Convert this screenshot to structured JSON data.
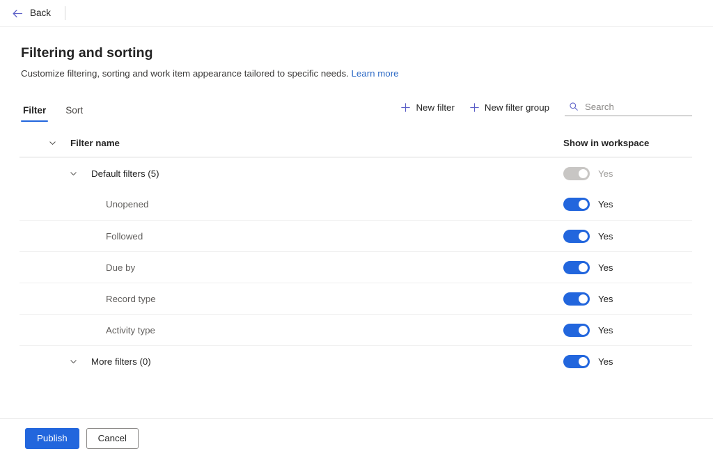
{
  "topbar": {
    "back_label": "Back",
    "back_icon": "arrow-left-icon"
  },
  "header": {
    "title": "Filtering and sorting",
    "subtitle": "Customize filtering, sorting and work item appearance tailored to specific needs.",
    "learn_more": "Learn more"
  },
  "tabs": [
    {
      "label": "Filter",
      "active": true
    },
    {
      "label": "Sort",
      "active": false
    }
  ],
  "commands": {
    "new_filter": "New filter",
    "new_filter_group": "New filter group",
    "plus_icon": "plus-icon",
    "search": {
      "placeholder": "Search",
      "value": "",
      "icon": "search-icon"
    }
  },
  "table": {
    "columns": {
      "name": "Filter name",
      "workspace": "Show in workspace"
    },
    "rows": [
      {
        "label": "Default filters (5)",
        "indent": 1,
        "chevron": true,
        "group": true,
        "toggle_on": true,
        "toggle_disabled": true,
        "toggle_label": "Yes",
        "divider": true
      },
      {
        "label": "Unopened",
        "indent": 2,
        "chevron": false,
        "group": false,
        "toggle_on": true,
        "toggle_disabled": false,
        "toggle_label": "Yes",
        "divider": false
      },
      {
        "label": "Followed",
        "indent": 2,
        "chevron": false,
        "group": false,
        "toggle_on": true,
        "toggle_disabled": false,
        "toggle_label": "Yes",
        "divider": true
      },
      {
        "label": "Due by",
        "indent": 2,
        "chevron": false,
        "group": false,
        "toggle_on": true,
        "toggle_disabled": false,
        "toggle_label": "Yes",
        "divider": true
      },
      {
        "label": "Record type",
        "indent": 2,
        "chevron": false,
        "group": false,
        "toggle_on": true,
        "toggle_disabled": false,
        "toggle_label": "Yes",
        "divider": true
      },
      {
        "label": "Activity type",
        "indent": 2,
        "chevron": false,
        "group": false,
        "toggle_on": true,
        "toggle_disabled": false,
        "toggle_label": "Yes",
        "divider": true
      },
      {
        "label": "More filters (0)",
        "indent": 1,
        "chevron": true,
        "group": true,
        "toggle_on": true,
        "toggle_disabled": false,
        "toggle_label": "Yes",
        "divider": true
      }
    ]
  },
  "footer": {
    "publish": "Publish",
    "cancel": "Cancel"
  },
  "colors": {
    "accent": "#2266dd",
    "link": "#2e6bc6",
    "toggle_on": "#2266dd",
    "toggle_disabled": "#c8c6c4",
    "divider": "#f0f0f0"
  }
}
